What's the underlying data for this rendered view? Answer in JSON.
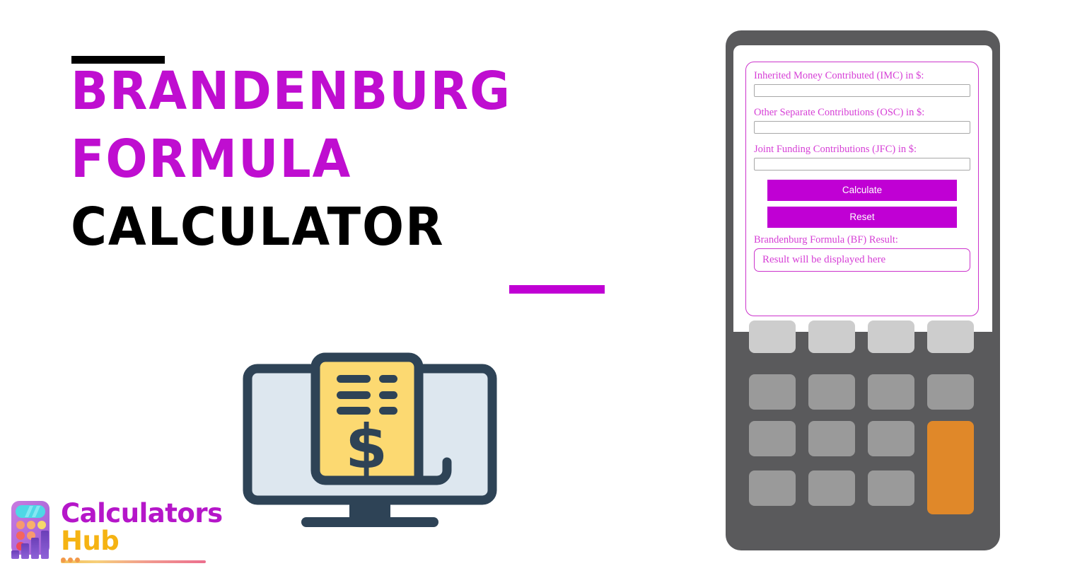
{
  "hero": {
    "title_lines": [
      "Brandenburg",
      "Formula",
      "Calculator"
    ],
    "accent_color": "#bf0ed0",
    "dark_color": "#000000"
  },
  "logo": {
    "word1": "Calculators",
    "word2": "Hub",
    "word1_color": "#b516c9",
    "word2_color": "#f5b313",
    "mark_icon": "calculator-bar-chart-icon"
  },
  "illustration": {
    "icon": "monitor-receipt-dollar-icon",
    "monitor_stroke": "#2e4356",
    "screen_fill": "#dde7ef",
    "receipt_fill": "#fcd971"
  },
  "calculator": {
    "frame_color": "#5a5a5c",
    "form": {
      "accent": "#c000d4",
      "label_color": "#d63fd6",
      "fields": [
        {
          "label": "Inherited Money Contributed (IMC) in $:",
          "value": "",
          "placeholder": ""
        },
        {
          "label": "Other Separate Contributions (OSC) in $:",
          "value": "",
          "placeholder": ""
        },
        {
          "label": "Joint Funding Contributions (JFC) in $:",
          "value": "",
          "placeholder": ""
        }
      ],
      "calculate_label": "Calculate",
      "reset_label": "Reset",
      "result_label": "Brandenburg Formula (BF) Result:",
      "result_text": "Result will be displayed here"
    },
    "keypad": {
      "light_color": "#cdcdcd",
      "mid_color": "#9a9a9a",
      "accent_color": "#e08829",
      "rows": 4,
      "cols": 4
    }
  }
}
